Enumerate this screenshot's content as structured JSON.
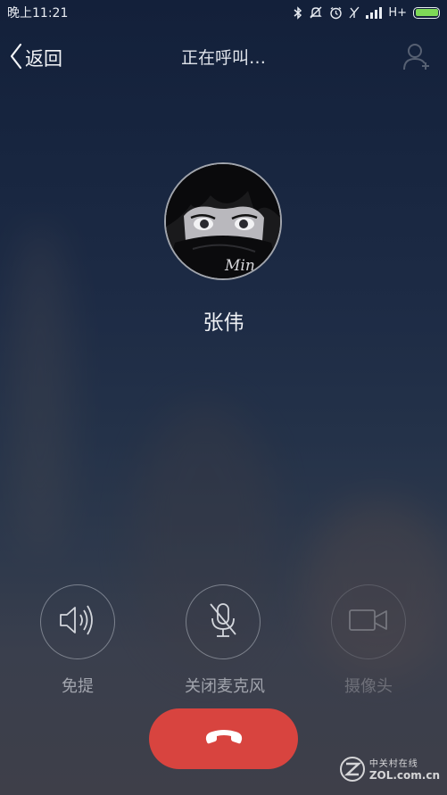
{
  "status_bar": {
    "time": "晚上11:21",
    "network": "H+",
    "battery_level": 1.0,
    "icons": [
      "bluetooth-icon",
      "silent-icon",
      "alarm-icon",
      "no-signal-icon",
      "signal-bars-icon",
      "battery-icon"
    ]
  },
  "header": {
    "back_label": "返回",
    "call_status": "正在呼叫…",
    "back_icon": "chevron-left-icon",
    "add_contact_icon": "add-contact-icon"
  },
  "caller": {
    "name": "张伟",
    "avatar_caption": "Min"
  },
  "controls": [
    {
      "label": "免提",
      "icon": "speaker-icon",
      "enabled": true
    },
    {
      "label": "关闭麦克风",
      "icon": "mic-off-icon",
      "enabled": true
    },
    {
      "label": "摄像头",
      "icon": "video-camera-icon",
      "enabled": false
    }
  ],
  "hangup": {
    "icon": "phone-hangup-icon",
    "color": "#d8443f"
  },
  "watermark": {
    "line1": "中关村在线",
    "line2": "ZOL.com.cn",
    "logo_letter": "Z"
  }
}
